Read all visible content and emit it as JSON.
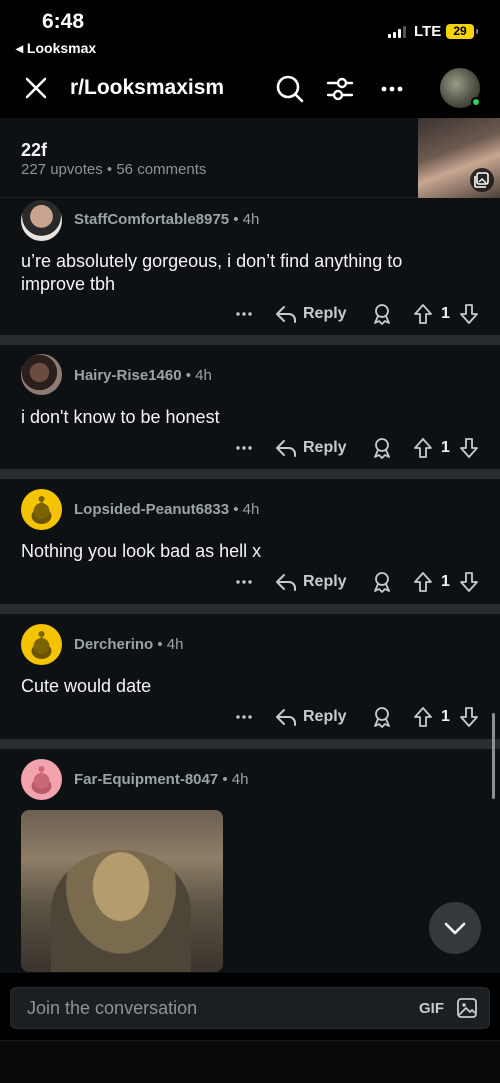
{
  "status_bar": {
    "time": "6:48",
    "back_app": "◂ Looksmax",
    "network": "LTE",
    "battery": "29"
  },
  "header": {
    "title": "r/Looksmaxism",
    "icons": [
      "close-icon",
      "search-icon",
      "filter-icon",
      "more-icon",
      "profile-avatar"
    ]
  },
  "post": {
    "title": "22f",
    "upvotes": "227 upvotes",
    "separator": "•",
    "comments": "56 comments"
  },
  "comments": [
    {
      "user": "StaffComfortable8975",
      "age": "4h",
      "text": "u’re absolutely gorgeous, i don’t find anything to improve tbh",
      "reply": "Reply",
      "score": "1"
    },
    {
      "user": "Hairy-Rise1460",
      "age": "4h",
      "text": "i don't know to be honest",
      "reply": "Reply",
      "score": "1"
    },
    {
      "user": "Lopsided-Peanut6833",
      "age": "4h",
      "text": "Nothing you look bad as hell x",
      "reply": "Reply",
      "score": "1"
    },
    {
      "user": "Dercherino",
      "age": "4h",
      "text": "Cute would date",
      "reply": "Reply",
      "score": "1"
    },
    {
      "user": "Far-Equipment-8047",
      "age": "4h",
      "text": "",
      "reply": "",
      "score": ""
    }
  ],
  "composer": {
    "placeholder": "Join the conversation",
    "gif_label": "GIF"
  },
  "colors": {
    "background": "#000000",
    "card": "#0e1113",
    "separator": "#2a2d2f",
    "snoo_yellow": "#f5c400",
    "online_green": "#2ed15a"
  }
}
